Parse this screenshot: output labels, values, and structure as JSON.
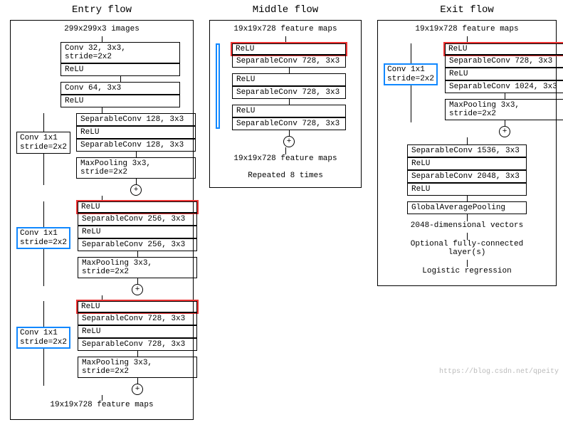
{
  "titles": {
    "entry": "Entry flow",
    "middle": "Middle flow",
    "exit": "Exit flow"
  },
  "entry": {
    "input": "299x299x3 images",
    "conv1": "Conv 32, 3x3, stride=2x2",
    "relu1": "ReLU",
    "conv2": "Conv 64, 3x3",
    "relu2": "ReLU",
    "blockA": {
      "side": "Conv 1x1\nstride=2x2",
      "l1": "SeparableConv 128, 3x3",
      "l2": "ReLU",
      "l3": "SeparableConv 128, 3x3",
      "l4": "MaxPooling 3x3, stride=2x2"
    },
    "blockB": {
      "side": "Conv 1x1\nstride=2x2",
      "l0": "ReLU",
      "l1": "SeparableConv 256, 3x3",
      "l2": "ReLU",
      "l3": "SeparableConv 256, 3x3",
      "l4": "MaxPooling 3x3, stride=2x2"
    },
    "blockC": {
      "side": "Conv 1x1\nstride=2x2",
      "l0": "ReLU",
      "l1": "SeparableConv 728, 3x3",
      "l2": "ReLU",
      "l3": "SeparableConv 728, 3x3",
      "l4": "MaxPooling 3x3, stride=2x2"
    },
    "output": "19x19x728 feature maps"
  },
  "middle": {
    "input": "19x19x728 feature maps",
    "l0": "ReLU",
    "l1": "SeparableConv 728, 3x3",
    "l2": "ReLU",
    "l3": "SeparableConv 728, 3x3",
    "l4": "ReLU",
    "l5": "SeparableConv 728, 3x3",
    "output": "19x19x728 feature maps",
    "note": "Repeated 8 times"
  },
  "exit": {
    "input": "19x19x728 feature maps",
    "blockA": {
      "side": "Conv 1x1\nstride=2x2",
      "l0": "ReLU",
      "l1": "SeparableConv 728, 3x3",
      "l2": "ReLU",
      "l3": "SeparableConv 1024, 3x3",
      "l4": "MaxPooling 3x3, stride=2x2"
    },
    "l1": "SeparableConv 1536, 3x3",
    "l2": "ReLU",
    "l3": "SeparableConv 2048, 3x3",
    "l4": "ReLU",
    "l5": "GlobalAveragePooling",
    "out1": "2048-dimensional vectors",
    "out2": "Optional fully-connected\nlayer(s)",
    "out3": "Logistic regression"
  },
  "plus": "+",
  "watermark": "https://blog.csdn.net/qpeity"
}
